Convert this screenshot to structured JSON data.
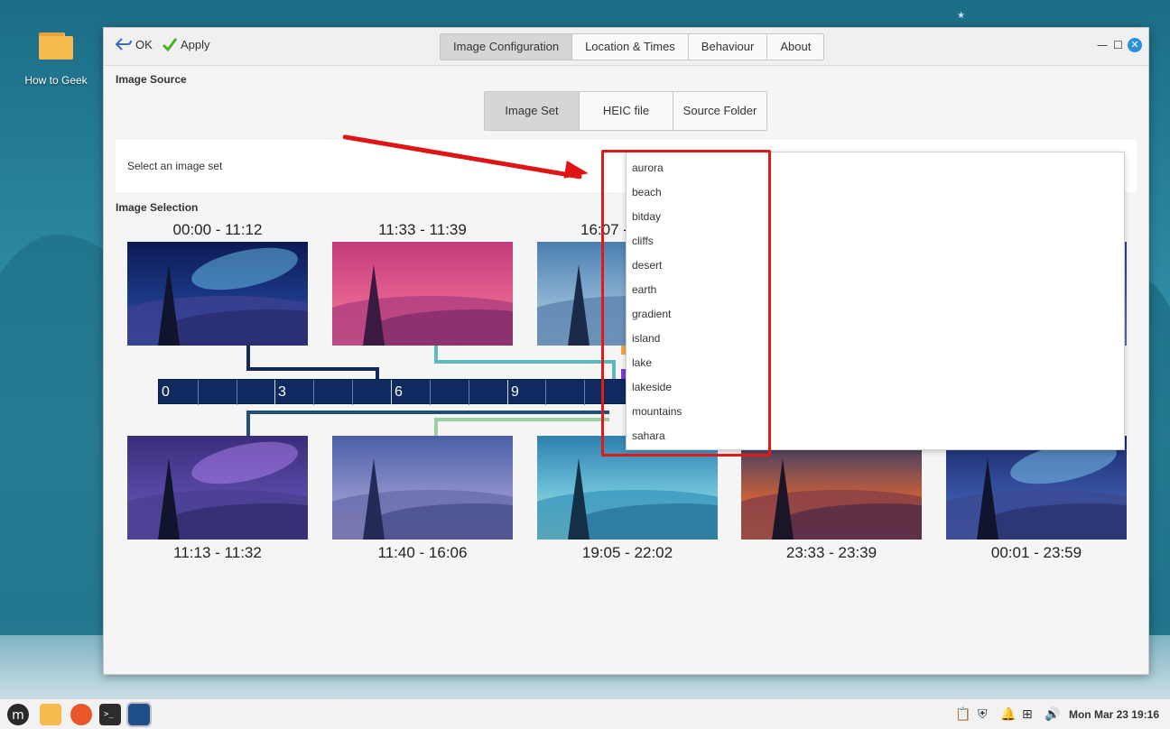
{
  "desktop": {
    "icon_label": "How to Geek"
  },
  "window": {
    "toolbar": {
      "ok_label": "OK",
      "apply_label": "Apply"
    },
    "tabs": [
      {
        "label": "Image Configuration",
        "active": true
      },
      {
        "label": "Location & Times"
      },
      {
        "label": "Behaviour"
      },
      {
        "label": "About"
      }
    ],
    "image_source": {
      "title": "Image Source",
      "source_tabs": [
        {
          "label": "Image Set",
          "active": true
        },
        {
          "label": "HEIC file"
        },
        {
          "label": "Source Folder"
        }
      ],
      "select_label": "Select an image set"
    },
    "image_selection": {
      "title": "Image Selection",
      "top_times": [
        "00:00 - 11:12",
        "11:33 - 11:39",
        "16:07 -"
      ],
      "bottom_times": [
        "11:13 - 11:32",
        "11:40 - 16:06",
        "19:05 - 22:02",
        "23:33 - 23:39",
        "00:01 - 23:59"
      ],
      "timeline_labels": [
        "0",
        "3",
        "6",
        "9"
      ]
    },
    "dropdown_options": [
      "aurora",
      "beach",
      "bitday",
      "cliffs",
      "desert",
      "earth",
      "gradient",
      "island",
      "lake",
      "lakeside",
      "mountains",
      "sahara"
    ]
  },
  "taskbar": {
    "apps": [
      "mint-menu-icon",
      "files-icon",
      "firefox-icon",
      "terminal-icon",
      "dynamic-wallpaper-icon"
    ],
    "clock": "Mon Mar 23 19:16"
  },
  "colors": {
    "accent": "#e01414",
    "timeline": "#0f2a5e"
  }
}
